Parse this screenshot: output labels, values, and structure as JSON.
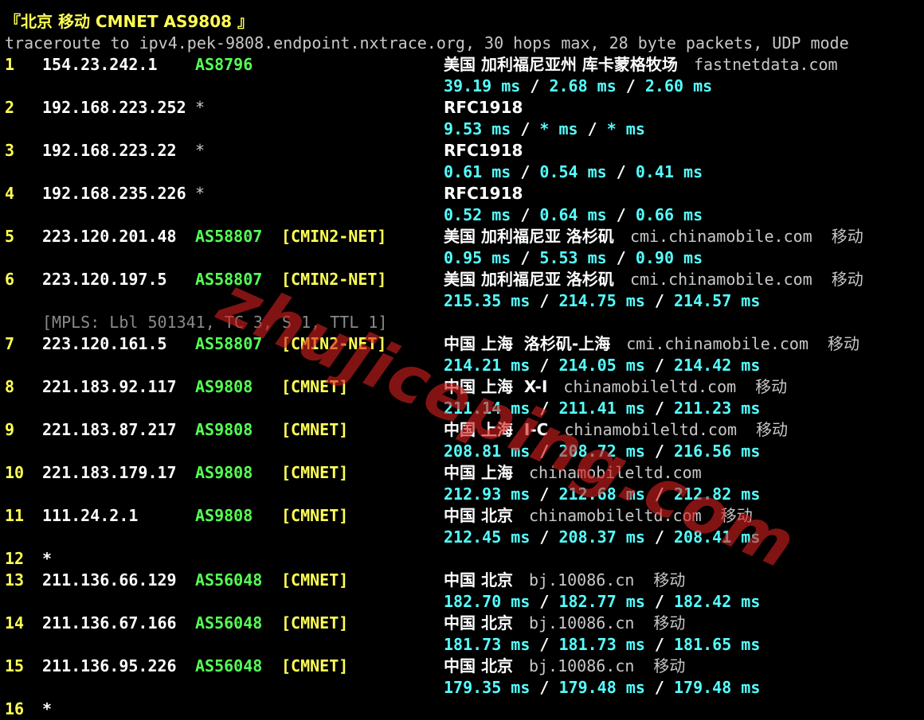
{
  "header": {
    "title": "『北京 移动 CMNET AS9808 』",
    "command": "traceroute to ipv4.pek-9808.endpoint.nxtrace.org, 30 hops max, 28 byte packets, UDP mode"
  },
  "colors": {
    "background": "#000000",
    "hop_number": "#ffff55",
    "ip": "#ffffff",
    "asn": "#55ff55",
    "net_tag": "#ffff55",
    "latency": "#55ffff",
    "mpls": "#8a8a8a",
    "watermark": "#d21e1e"
  },
  "hops": [
    {
      "hop": "1",
      "ip": "154.23.242.1",
      "asn": "AS8796",
      "tag": "",
      "geo": "美国 加利福尼亚州 库卡蒙格牧场",
      "domain": "fastnetdata.com",
      "isp": "",
      "latency": "39.19 ms / 2.68 ms / 2.60 ms"
    },
    {
      "hop": "2",
      "ip": "192.168.223.252",
      "asn": "*",
      "tag": "",
      "geo": "RFC1918",
      "domain": "",
      "isp": "",
      "latency": "9.53 ms / * ms / * ms"
    },
    {
      "hop": "3",
      "ip": "192.168.223.22",
      "asn": "*",
      "tag": "",
      "geo": "RFC1918",
      "domain": "",
      "isp": "",
      "latency": "0.61 ms / 0.54 ms / 0.41 ms"
    },
    {
      "hop": "4",
      "ip": "192.168.235.226",
      "asn": "*",
      "tag": "",
      "geo": "RFC1918",
      "domain": "",
      "isp": "",
      "latency": "0.52 ms / 0.64 ms / 0.66 ms"
    },
    {
      "hop": "5",
      "ip": "223.120.201.48",
      "asn": "AS58807",
      "tag": "[CMIN2-NET]",
      "geo": "美国 加利福尼亚 洛杉矶",
      "domain": "cmi.chinamobile.com",
      "isp": "移动",
      "latency": "0.95 ms / 5.53 ms / 0.90 ms"
    },
    {
      "hop": "6",
      "ip": "223.120.197.5",
      "asn": "AS58807",
      "tag": "[CMIN2-NET]",
      "geo": "美国 加利福尼亚 洛杉矶",
      "domain": "cmi.chinamobile.com",
      "isp": "移动",
      "latency": "215.35 ms / 214.75 ms / 214.57 ms"
    },
    {
      "hop": "7",
      "ip": "223.120.161.5",
      "asn": "AS58807",
      "tag": "[CMIN2-NET]",
      "geo": "中国 上海  洛杉矶-上海",
      "domain": "cmi.chinamobile.com",
      "isp": "移动",
      "latency": "214.21 ms / 214.05 ms / 214.42 ms"
    },
    {
      "hop": "8",
      "ip": "221.183.92.117",
      "asn": "AS9808",
      "tag": "[CMNET]",
      "geo": "中国 上海  X-I",
      "domain": "chinamobileltd.com",
      "isp": "移动",
      "latency": "211.14 ms / 211.41 ms / 211.23 ms"
    },
    {
      "hop": "9",
      "ip": "221.183.87.217",
      "asn": "AS9808",
      "tag": "[CMNET]",
      "geo": "中国 上海  I-C",
      "domain": "chinamobileltd.com",
      "isp": "移动",
      "latency": "208.81 ms / 208.72 ms / 216.56 ms"
    },
    {
      "hop": "10",
      "ip": "221.183.179.17",
      "asn": "AS9808",
      "tag": "[CMNET]",
      "geo": "中国 上海",
      "domain": "chinamobileltd.com",
      "isp": "",
      "latency": "212.93 ms / 212.68 ms / 212.82 ms"
    },
    {
      "hop": "11",
      "ip": "111.24.2.1",
      "asn": "AS9808",
      "tag": "[CMNET]",
      "geo": "中国 北京",
      "domain": "chinamobileltd.com",
      "isp": "移动",
      "latency": "212.45 ms / 208.37 ms / 208.41 ms"
    },
    {
      "hop": "12",
      "ip": "*",
      "asn": "",
      "tag": "",
      "geo": "",
      "domain": "",
      "isp": "",
      "latency": ""
    },
    {
      "hop": "13",
      "ip": "211.136.66.129",
      "asn": "AS56048",
      "tag": "[CMNET]",
      "geo": "中国 北京",
      "domain": "bj.10086.cn",
      "isp": "移动",
      "latency": "182.70 ms / 182.77 ms / 182.42 ms"
    },
    {
      "hop": "14",
      "ip": "211.136.67.166",
      "asn": "AS56048",
      "tag": "[CMNET]",
      "geo": "中国 北京",
      "domain": "bj.10086.cn",
      "isp": "移动",
      "latency": "181.73 ms / 181.73 ms / 181.65 ms"
    },
    {
      "hop": "15",
      "ip": "211.136.95.226",
      "asn": "AS56048",
      "tag": "[CMNET]",
      "geo": "中国 北京",
      "domain": "bj.10086.cn",
      "isp": "移动",
      "latency": "179.35 ms / 179.48 ms / 179.48 ms"
    },
    {
      "hop": "16",
      "ip": "*",
      "asn": "",
      "tag": "",
      "geo": "",
      "domain": "",
      "isp": "",
      "latency": ""
    }
  ],
  "mpls": "[MPLS: Lbl 501341, TC 3, S 1, TTL 1]",
  "watermark": "zhujiceping.com"
}
